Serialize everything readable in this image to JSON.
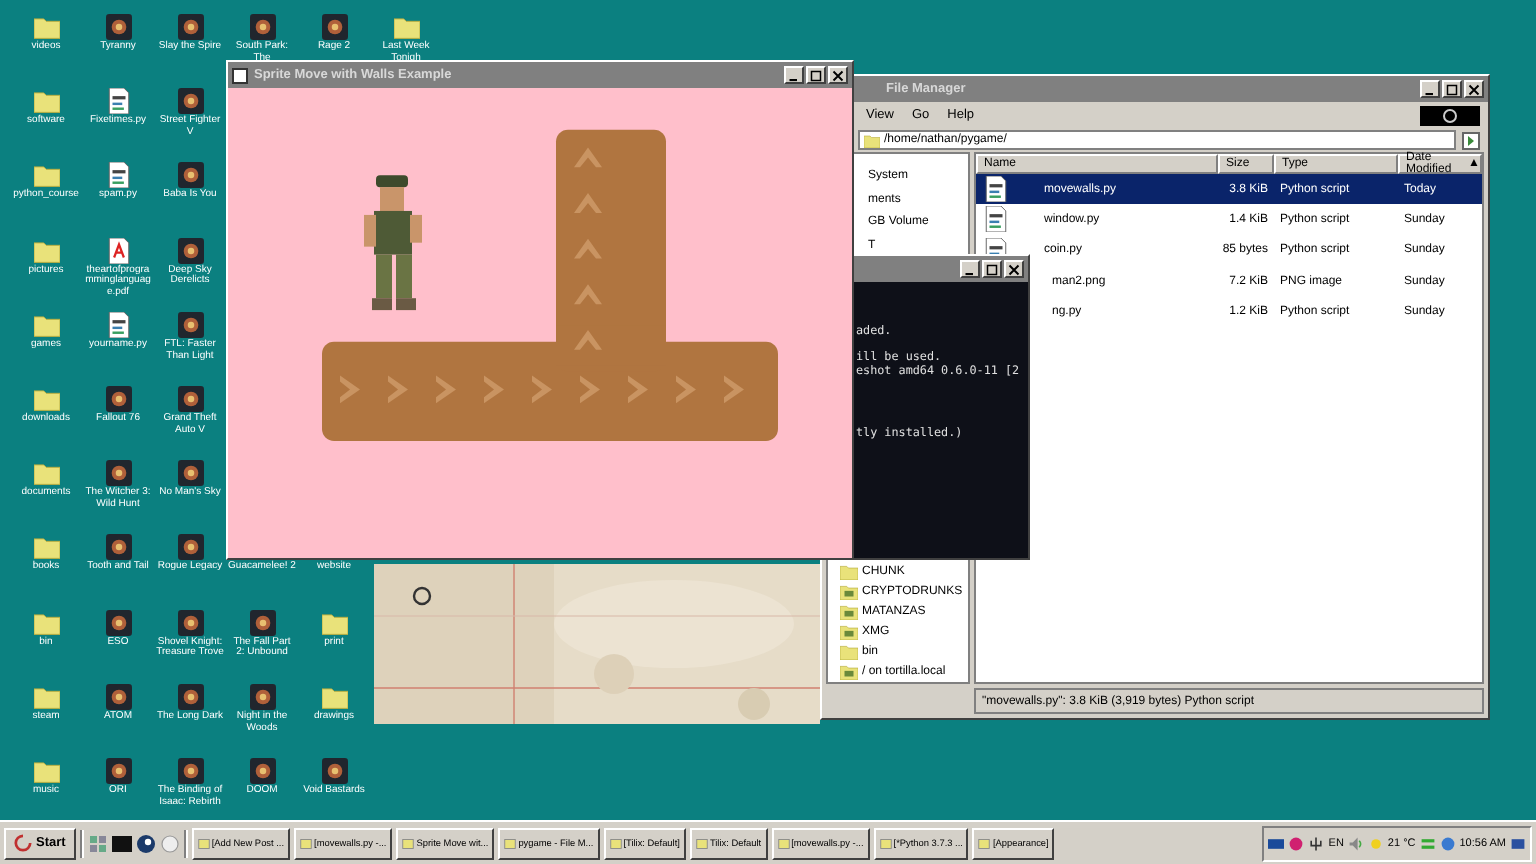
{
  "desktop": {
    "columns": [
      {
        "top": [
          {
            "label": "videos",
            "kind": "folder"
          },
          {
            "label": "software",
            "kind": "folder"
          },
          {
            "label": "python_course",
            "kind": "folder"
          },
          {
            "label": "pictures",
            "kind": "folder"
          },
          {
            "label": "games",
            "kind": "folder"
          },
          {
            "label": "downloads",
            "kind": "folder"
          },
          {
            "label": "documents",
            "kind": "folder"
          },
          {
            "label": "books",
            "kind": "folder"
          },
          {
            "label": "bin",
            "kind": "folder"
          },
          {
            "label": "steam",
            "kind": "folder"
          },
          {
            "label": "music",
            "kind": "folder"
          }
        ]
      },
      {
        "top": [
          {
            "label": "Tyranny",
            "kind": "app"
          },
          {
            "label": "Fixetimes.py",
            "kind": "script"
          },
          {
            "label": "spam.py",
            "kind": "script"
          },
          {
            "label": "theartofprogramminglanguage.pdf",
            "kind": "pdf"
          },
          {
            "label": "yourname.py",
            "kind": "script"
          },
          {
            "label": "Fallout 76",
            "kind": "app"
          },
          {
            "label": "The Witcher 3: Wild Hunt",
            "kind": "app"
          },
          {
            "label": "Tooth and Tail",
            "kind": "app"
          },
          {
            "label": "ESO",
            "kind": "app"
          },
          {
            "label": "ATOM",
            "kind": "app"
          },
          {
            "label": "ORI",
            "kind": "app"
          }
        ]
      },
      {
        "top": [
          {
            "label": "Slay the Spire",
            "kind": "app"
          },
          {
            "label": "Street Fighter V",
            "kind": "app"
          },
          {
            "label": "Baba Is You",
            "kind": "app"
          },
          {
            "label": "Deep Sky Derelicts",
            "kind": "app"
          },
          {
            "label": "FTL: Faster Than Light",
            "kind": "app"
          },
          {
            "label": "Grand Theft Auto V",
            "kind": "app"
          },
          {
            "label": "No Man's Sky",
            "kind": "app"
          },
          {
            "label": "Rogue Legacy",
            "kind": "app"
          },
          {
            "label": "Shovel Knight: Treasure Trove",
            "kind": "app"
          },
          {
            "label": "The Long Dark",
            "kind": "app"
          },
          {
            "label": "The Binding of Isaac: Rebirth",
            "kind": "app"
          }
        ]
      },
      {
        "top": [
          {
            "label": "South Park: The",
            "kind": "app"
          }
        ],
        "bottom": [
          {
            "label": "Guacamelee! 2"
          },
          {
            "label": "The Fall Part 2: Unbound",
            "kind": "app"
          },
          {
            "label": "Night in the Woods",
            "kind": "app"
          },
          {
            "label": "DOOM",
            "kind": "app"
          }
        ]
      },
      {
        "top": [
          {
            "label": "Rage 2",
            "kind": "app"
          }
        ],
        "bottom": [
          {
            "label": "website"
          },
          {
            "label": "print",
            "kind": "folder"
          },
          {
            "label": "drawings",
            "kind": "folder"
          },
          {
            "label": "Void Bastards",
            "kind": "app"
          }
        ]
      },
      {
        "top": [
          {
            "label": "Last Week Tonigh",
            "kind": "folder"
          }
        ]
      }
    ]
  },
  "game_window": {
    "title": "Sprite Move with Walls Example"
  },
  "terminal": {
    "lines": [
      "aded.",
      "ill be used.",
      "eshot amd64 0.6.0-11 [2",
      "tly installed.)"
    ]
  },
  "file_manager": {
    "title": "File Manager",
    "menu": [
      "View",
      "Go",
      "Help"
    ],
    "path": "/home/nathan/pygame/",
    "pane_top": [
      "System",
      "ments",
      "GB Volume",
      "T"
    ],
    "pane_bottom": [
      {
        "label": "CHUNK",
        "kind": "folder"
      },
      {
        "label": "CRYPTODRUNKS",
        "kind": "share"
      },
      {
        "label": "MATANZAS",
        "kind": "share"
      },
      {
        "label": "XMG",
        "kind": "share"
      },
      {
        "label": "bin",
        "kind": "folder"
      },
      {
        "label": "/ on tortilla.local",
        "kind": "share"
      }
    ],
    "columns": [
      "Name",
      "Size",
      "Type",
      "Date Modified"
    ],
    "sort_indicator": "▲",
    "rows": [
      {
        "name": "movewalls.py",
        "size": "3.8 KiB",
        "type": "Python script",
        "modified": "Today",
        "selected": true,
        "kind": "script"
      },
      {
        "name": "window.py",
        "size": "1.4 KiB",
        "type": "Python script",
        "modified": "Sunday",
        "selected": false,
        "kind": "script"
      },
      {
        "name": "coin.py",
        "size": "85 bytes",
        "type": "Python script",
        "modified": "Sunday",
        "selected": false,
        "kind": "script"
      },
      {
        "name": "man2.png",
        "size": "7.2 KiB",
        "type": "PNG image",
        "modified": "Sunday",
        "selected": false
      },
      {
        "name": "ng.py",
        "size": "1.2 KiB",
        "type": "Python script",
        "modified": "Sunday",
        "selected": false
      }
    ],
    "status": "\"movewalls.py\": 3.8 KiB (3,919 bytes) Python script"
  },
  "taskbar": {
    "start": "Start",
    "tasks": [
      "[Add New Post ...",
      "[movewalls.py -...",
      "Sprite Move wit...",
      "pygame - File M...",
      "[Tilix: Default]",
      "Tilix: Default",
      "[movewalls.py -...",
      "[*Python 3.7.3 ...",
      "[Appearance]"
    ],
    "language": "EN",
    "temperature": "21 °C",
    "clock": "10:56 AM"
  }
}
